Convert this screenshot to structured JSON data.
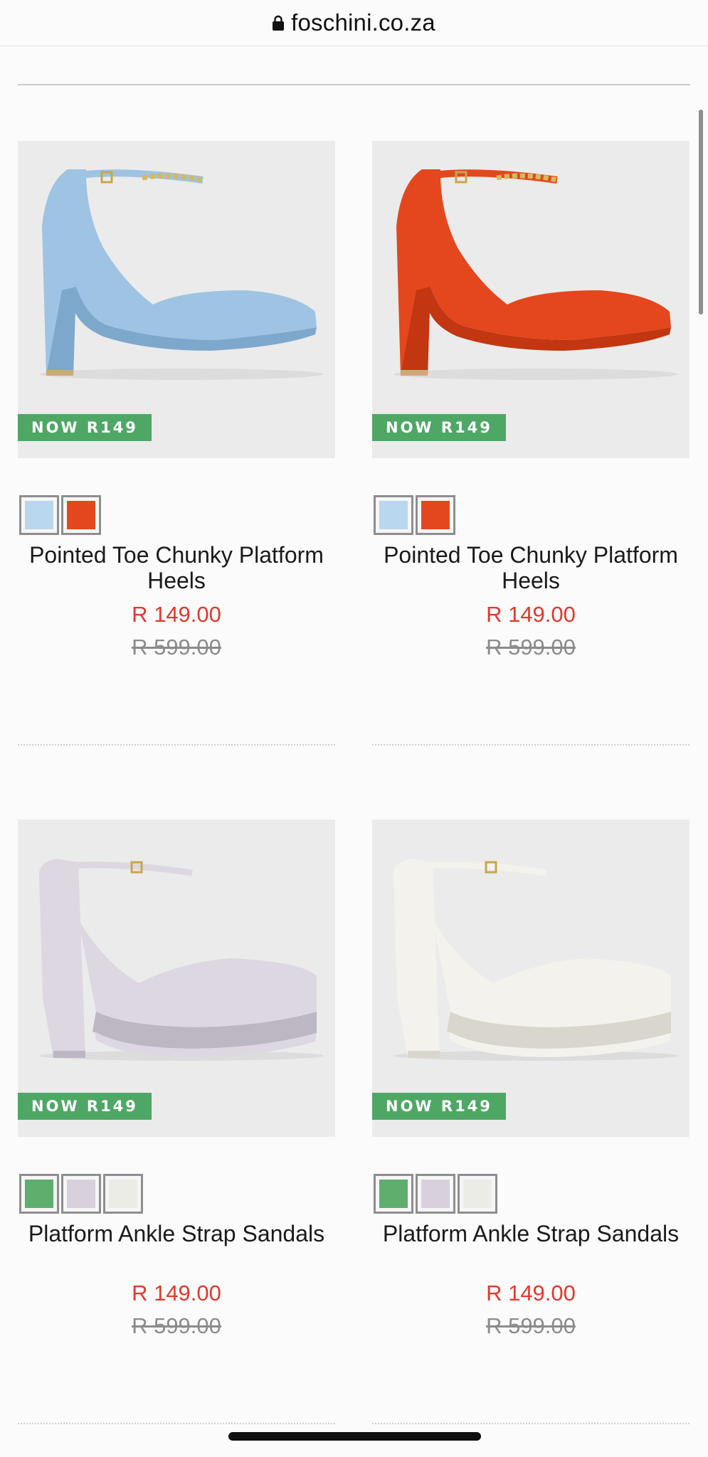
{
  "browser": {
    "url": "foschini.co.za"
  },
  "colors": {
    "badge": "#4fa766",
    "sale_price": "#e0392b",
    "was_price": "#8b8b8b"
  },
  "products": [
    {
      "name": "Pointed Toe Chunky Platform Heels",
      "badge": "NOW R149",
      "price_now": "R 149.00",
      "price_was": "R 599.00",
      "shoe_color": "#9ec3e3",
      "shoe_shade": "#7ea7cc",
      "swatches": [
        "#b9d7ef",
        "#e4471d"
      ]
    },
    {
      "name": "Pointed Toe Chunky Platform Heels",
      "badge": "NOW R149",
      "price_now": "R 149.00",
      "price_was": "R 599.00",
      "shoe_color": "#e4471d",
      "shoe_shade": "#c23612",
      "swatches": [
        "#b9d7ef",
        "#e4471d"
      ]
    },
    {
      "name": "Platform Ankle Strap Sandals",
      "badge": "NOW R149",
      "price_now": "R 149.00",
      "price_was": "R 599.00",
      "shoe_color": "#dcd7e0",
      "shoe_shade": "#bdb6c3",
      "swatches": [
        "#5fae6e",
        "#d8d1dd",
        "#ecece7"
      ]
    },
    {
      "name": "Platform Ankle Strap Sandals",
      "badge": "NOW R149",
      "price_now": "R 149.00",
      "price_was": "R 599.00",
      "shoe_color": "#f3f2ec",
      "shoe_shade": "#d9d7cd",
      "swatches": [
        "#5fae6e",
        "#d8d1dd",
        "#ecece7"
      ]
    }
  ]
}
